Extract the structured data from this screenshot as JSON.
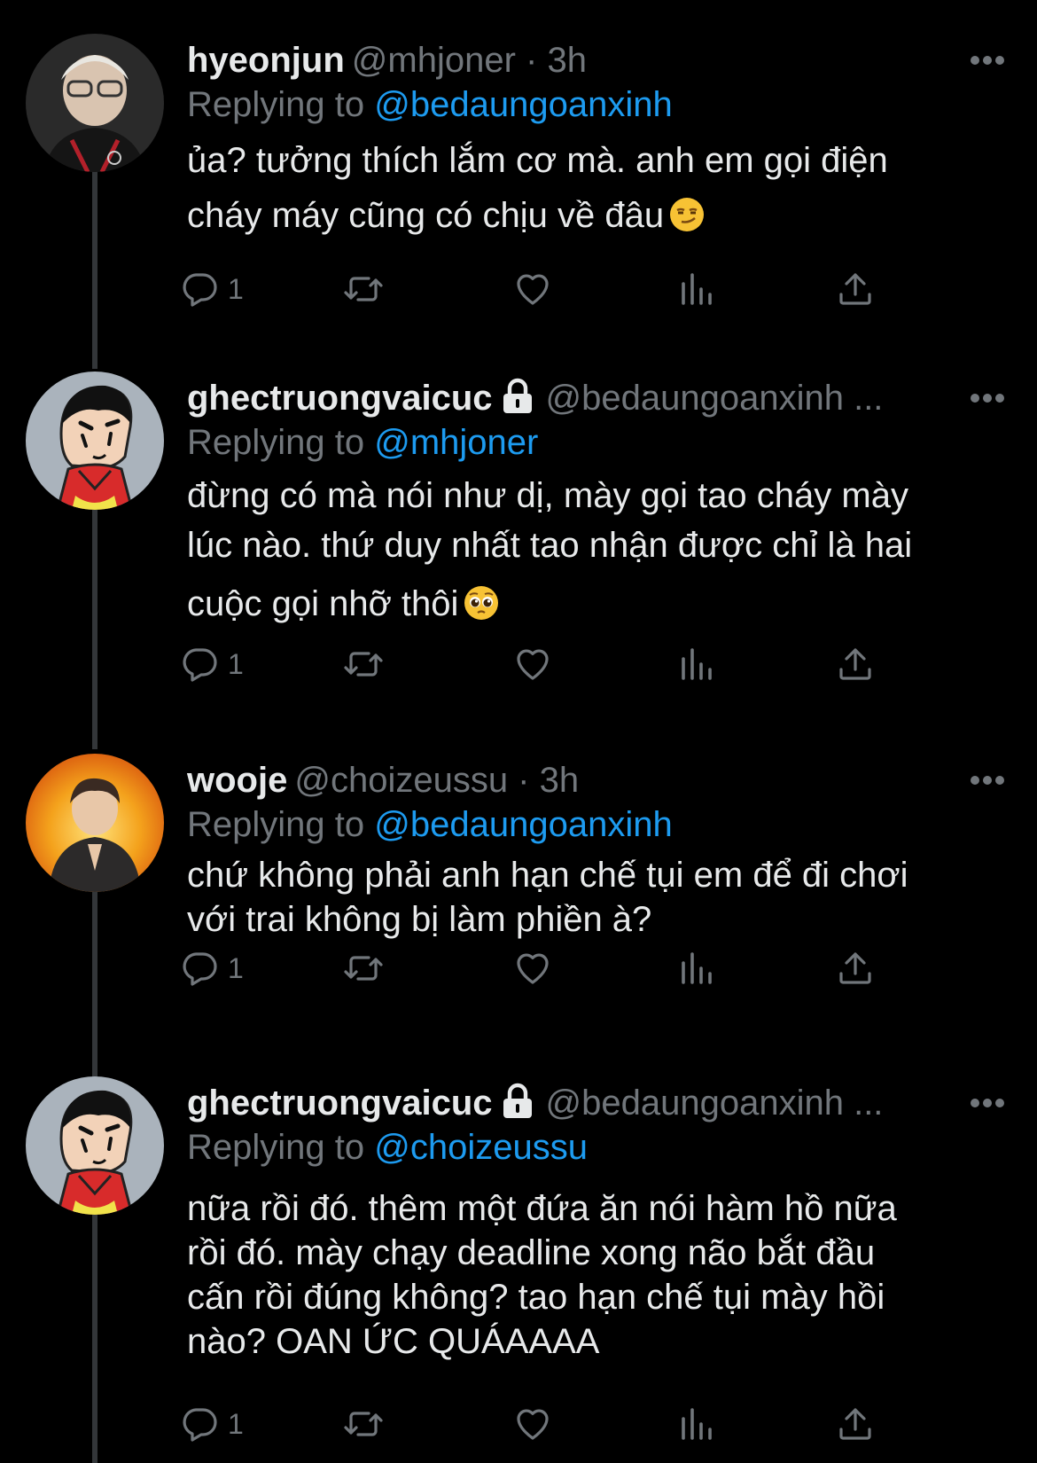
{
  "tweets": [
    {
      "name": "hyeonjun",
      "handle": "@mhjoner · 3h",
      "locked": false,
      "reply_prefix": "Replying to",
      "reply_mention": "@bedaungoanxinh",
      "lines": [
        "ủa? tưởng thích lắm cơ mà. anh em gọi điện",
        "cháy máy cũng có chịu về đâu"
      ],
      "emoji": "smirk",
      "reply_count": "1",
      "avatar": "avatar-photo-hyeonjun"
    },
    {
      "name": "ghectruongvaicuc",
      "handle": "@bedaungoanxinh ...",
      "locked": true,
      "reply_prefix": "Replying to",
      "reply_mention": "@mhjoner",
      "lines": [
        "đừng có mà nói như dị, mày gọi tao cháy mày",
        "lúc nào. thứ duy nhất tao nhận được chỉ là hai",
        "cuộc gọi nhỡ thôi"
      ],
      "emoji": "pleading",
      "reply_count": "1",
      "avatar": "avatar-cartoon-shinchan"
    },
    {
      "name": "wooje",
      "handle": "@choizeussu · 3h",
      "locked": false,
      "reply_prefix": "Replying to",
      "reply_mention": "@bedaungoanxinh",
      "lines": [
        "chứ không phải anh hạn chế tụi em để đi chơi",
        "với trai không bị làm phiền à?"
      ],
      "emoji": "",
      "reply_count": "1",
      "avatar": "avatar-photo-wooje"
    },
    {
      "name": "ghectruongvaicuc",
      "handle": "@bedaungoanxinh ...",
      "locked": true,
      "reply_prefix": "Replying to",
      "reply_mention": "@choizeussu",
      "lines": [
        "nữa rồi đó. thêm một đứa ăn nói hàm hồ nữa",
        "rồi đó. mày chạy deadline xong não bắt đầu",
        "cấn rồi đúng không? tao hạn chế tụi mày hồi",
        "nào? OAN ỨC QUÁAAAA"
      ],
      "emoji": "",
      "reply_count": "1",
      "avatar": "avatar-cartoon-shinchan"
    }
  ],
  "icons": {
    "reply": "reply-icon",
    "retweet": "retweet-icon",
    "like": "like-icon",
    "views": "views-icon",
    "share": "share-icon",
    "more": "more-icon",
    "lock": "lock-icon"
  },
  "colors": {
    "background": "#000000",
    "text": "#e7e9ea",
    "secondary": "#71767b",
    "link": "#1d9bf0",
    "thread_line": "#333639"
  }
}
